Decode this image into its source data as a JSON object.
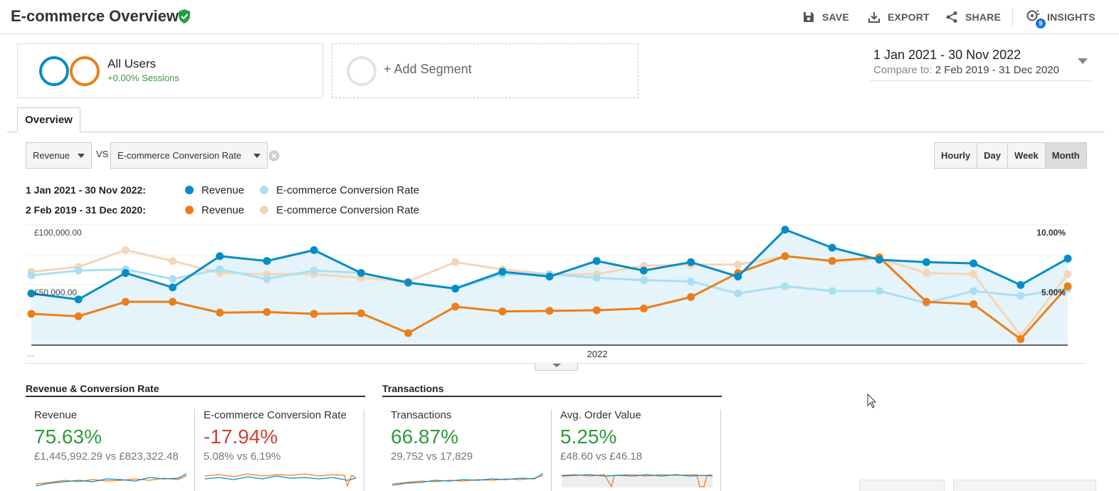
{
  "header": {
    "title": "E-commerce Overview",
    "save": "SAVE",
    "export": "EXPORT",
    "share": "SHARE",
    "insights": "INSIGHTS",
    "insights_badge": "9"
  },
  "segments": {
    "primary": {
      "name": "All Users",
      "sub": "+0.00% Sessions"
    },
    "add_label": "+ Add Segment"
  },
  "daterange": {
    "main": "1 Jan 2021 - 30 Nov 2022",
    "compare_prefix": "Compare to:",
    "compare_value": "2 Feb 2019 - 31 Dec 2020"
  },
  "tabs": [
    {
      "label": "Overview"
    }
  ],
  "metric_select": {
    "primary": "Revenue",
    "vs": "VS",
    "secondary": "E-commerce Conversion Rate"
  },
  "granularity": {
    "options": [
      "Hourly",
      "Day",
      "Week",
      "Month"
    ],
    "active": "Month"
  },
  "legend": {
    "current": {
      "date": "1 Jan 2021 - 30 Nov 2022:",
      "series": [
        {
          "name": "Revenue",
          "color": "#058dc7"
        },
        {
          "name": "E-commerce Conversion Rate",
          "color": "#aadff3"
        }
      ]
    },
    "previous": {
      "date": "2 Feb 2019 - 31 Dec 2020:",
      "series": [
        {
          "name": "Revenue",
          "color": "#ed7e17"
        },
        {
          "name": "E-commerce Conversion Rate",
          "color": "#f5d5b8"
        }
      ]
    }
  },
  "chart_data": {
    "type": "line",
    "y_left_ticks": [
      "£100,000.00",
      "£50,000.00"
    ],
    "y_right_ticks": [
      "10.00%",
      "5.00%"
    ],
    "y_left_range": [
      0,
      100000
    ],
    "y_right_range": [
      0,
      10
    ],
    "x_label_start": "...",
    "x_label_mid": "2022",
    "points": 23,
    "series": [
      {
        "name": "Revenue",
        "axis": "left",
        "color": "#058dc7",
        "values": [
          43000,
          38000,
          60000,
          48000,
          74000,
          70000,
          79000,
          60000,
          52000,
          47000,
          61000,
          57000,
          70000,
          62000,
          69000,
          57000,
          96000,
          81000,
          71000,
          69000,
          68000,
          50000,
          72000
        ]
      },
      {
        "name": "E-commerce Conversion Rate",
        "axis": "right",
        "color": "#aadff3",
        "values": [
          5.8,
          6.2,
          6.3,
          5.5,
          6.3,
          5.5,
          6.2,
          6.0,
          5.2,
          4.7,
          5.9,
          5.9,
          5.6,
          5.4,
          5.3,
          4.3,
          4.9,
          4.5,
          4.5,
          3.5,
          4.5,
          4.1,
          4.7
        ]
      },
      {
        "name": "Revenue",
        "axis": "left",
        "color": "#ed7e17",
        "values": [
          26000,
          24000,
          36000,
          36000,
          27000,
          27500,
          26000,
          26500,
          10000,
          32000,
          28000,
          28500,
          29000,
          30500,
          40000,
          60000,
          74000,
          70000,
          73000,
          36000,
          34000,
          5000,
          49000
        ]
      },
      {
        "name": "E-commerce Conversion Rate",
        "axis": "right",
        "color": "#f5d5b8",
        "values": [
          6.1,
          6.5,
          7.9,
          7.0,
          6.0,
          5.9,
          5.9,
          5.6,
          5.3,
          6.9,
          6.3,
          5.9,
          5.9,
          6.6,
          6.7,
          6.7,
          7.4,
          7.0,
          7.2,
          6.0,
          5.9,
          0.8,
          5.9
        ]
      }
    ]
  },
  "scorecards": {
    "group1_title": "Revenue & Conversion Rate",
    "group2_title": "Transactions",
    "cards": [
      {
        "label": "Revenue",
        "change": "75.63%",
        "compare": "£1,445,992.29 vs £823,322.48"
      },
      {
        "label": "E-commerce Conversion Rate",
        "change": "-17.94%",
        "compare": "5.08% vs 6.19%"
      },
      {
        "label": "Transactions",
        "change": "66.87%",
        "compare": "29,752 vs 17,829"
      },
      {
        "label": "Avg. Order Value",
        "change": "5.25%",
        "compare": "£48.60 vs £46.18"
      }
    ]
  }
}
